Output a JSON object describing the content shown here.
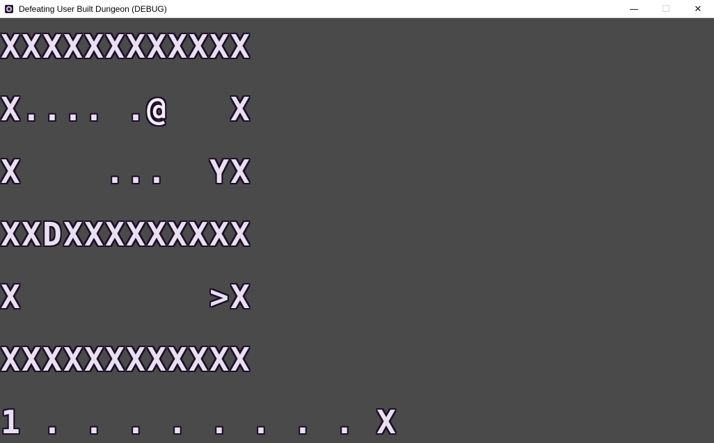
{
  "window": {
    "title": "Defeating User Built Dungeon (DEBUG)",
    "minimize_glyph": "—",
    "maximize_glyph": "☐",
    "close_glyph": "✕"
  },
  "map": {
    "rows": [
      "XXXXXXXXXXXX",
      "X.... .@   X",
      "X    ...  YX",
      "XXDXXXXXXXXX",
      "X         >X",
      "XXXXXXXXXXXX",
      "1 . . . . . . . . X"
    ]
  }
}
